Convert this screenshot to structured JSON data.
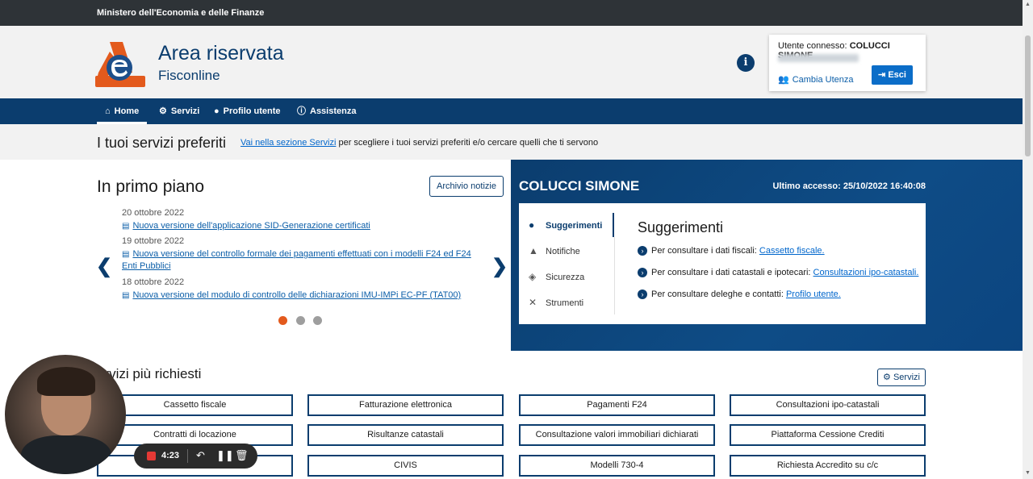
{
  "topbar": {
    "ministry": "Ministero dell'Economia e delle Finanze"
  },
  "header": {
    "title": "Area riservata",
    "subtitle": "Fisconline",
    "info_icon": "i",
    "user": {
      "label": "Utente connesso:",
      "name": "COLUCCI SIMONE",
      "cambia": "Cambia Utenza",
      "esci": "Esci"
    }
  },
  "nav": {
    "items": [
      {
        "label": "Home",
        "icon": "home-icon"
      },
      {
        "label": "Servizi",
        "icon": "cogs-icon"
      },
      {
        "label": "Profilo utente",
        "icon": "user-icon"
      },
      {
        "label": "Assistenza",
        "icon": "info-circle-icon"
      }
    ]
  },
  "preferiti": {
    "title": "I tuoi servizi preferiti",
    "link": "Vai nella sezione Servizi",
    "text": " per scegliere i tuoi servizi preferiti e/o cercare quelli che ti servono"
  },
  "primo_piano": {
    "title": "In primo piano",
    "archivio": "Archivio notizie",
    "news": [
      {
        "date": "20 ottobre 2022",
        "title": "Nuova versione dell'applicazione SID-Generazione certificati"
      },
      {
        "date": "19 ottobre 2022",
        "title": "Nuova versione del controllo formale dei pagamenti effettuati con i modelli F24 ed F24 Enti Pubblici"
      },
      {
        "date": "18 ottobre 2022",
        "title": "Nuova versione del modulo di controllo delle dichiarazioni IMU-IMPi EC-PF (TAT00)"
      }
    ],
    "prev": "❮",
    "next": "❯"
  },
  "profile": {
    "name": "COLUCCI SIMONE",
    "last_access": "Ultimo accesso: 25/10/2022 16:40:08",
    "menu": [
      {
        "label": "Suggerimenti",
        "icon": "lightbulb-icon"
      },
      {
        "label": "Notifiche",
        "icon": "bell-icon"
      },
      {
        "label": "Sicurezza",
        "icon": "shield-icon"
      },
      {
        "label": "Strumenti",
        "icon": "tools-icon"
      }
    ],
    "suggerimenti": {
      "title": "Suggerimenti",
      "lines": [
        {
          "text": "Per consultare i dati fiscali: ",
          "link": "Cassetto fiscale."
        },
        {
          "text": "Per consultare i dati catastali e ipotecari: ",
          "link": "Consultazioni ipo-catastali."
        },
        {
          "text": "Per consultare deleghe e contatti: ",
          "link": "Profilo utente."
        }
      ]
    }
  },
  "servizi_richiesti": {
    "title": "ervizi più richiesti",
    "button": "Servizi",
    "items": [
      "Cassetto fiscale",
      "Fatturazione elettronica",
      "Pagamenti F24",
      "Consultazioni ipo-catastali",
      "Contratti di locazione",
      "Risultanze catastali",
      "Consultazione valori immobiliari dichiarati",
      "Piattaforma Cessione Crediti",
      "",
      "CIVIS",
      "Modelli 730-4",
      "Richiesta Accredito su c/c"
    ]
  },
  "recorder": {
    "time": "4:23"
  },
  "colors": {
    "primary": "#0b3d6e",
    "accent": "#e35a1d",
    "link": "#0b5ea8"
  }
}
